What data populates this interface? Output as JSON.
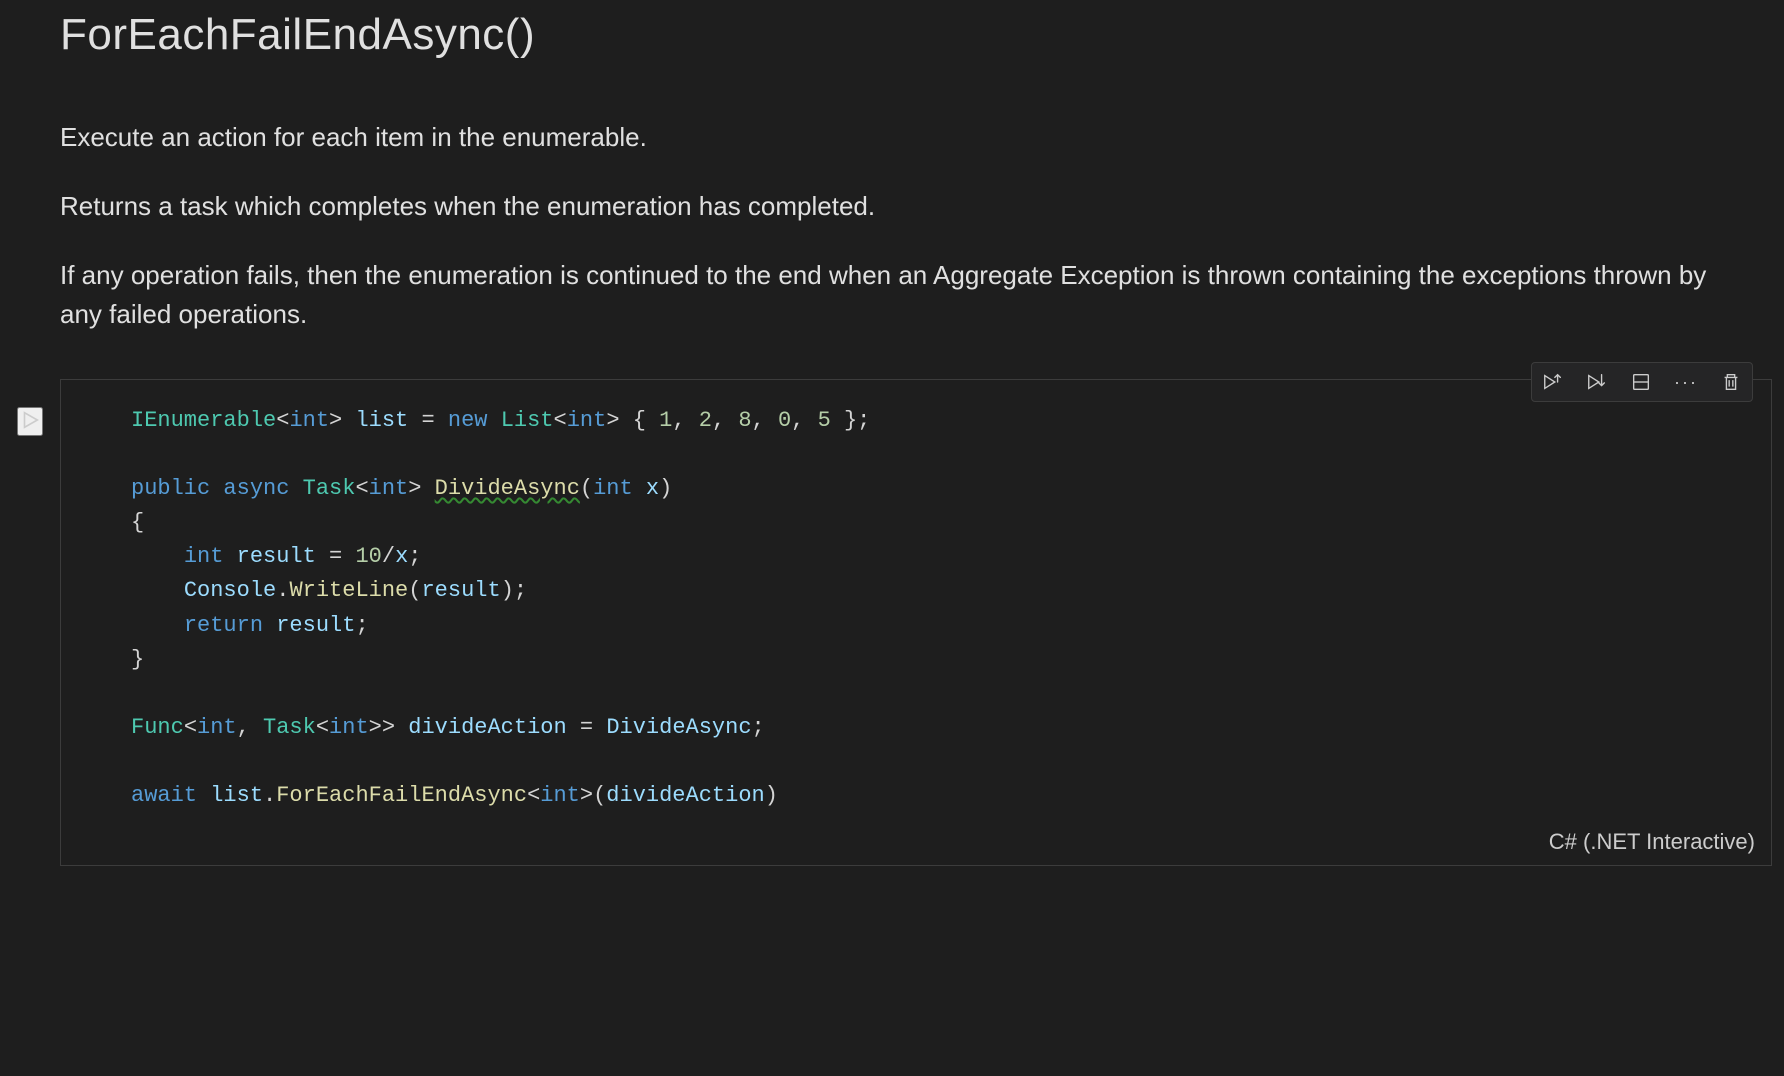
{
  "header": {
    "title": "ForEachFailEndAsync()"
  },
  "description": {
    "p1": "Execute an action for each item in the enumerable.",
    "p2": "Returns a task which completes when the enumeration has completed.",
    "p3": "If any operation fails, then the enumeration is continued to the end when an Aggregate Exception is thrown containing the exceptions thrown by any failed operations."
  },
  "cell": {
    "language_label": "C# (.NET Interactive)",
    "code": {
      "line1": {
        "kw1": "IEnumerable",
        "type1": "int",
        "var1": "list",
        "op1": "=",
        "kw2": "new",
        "type2": "List",
        "type3": "int",
        "nums": "1, 2, 8, 0, 5",
        "n1": "1",
        "n2": "2",
        "n3": "8",
        "n4": "0",
        "n5": "5"
      },
      "line2": {
        "kw1": "public",
        "kw2": "async",
        "type1": "Task",
        "type2": "int",
        "fn": "DivideAsync",
        "ptype": "int",
        "pname": "x"
      },
      "line3": {
        "type": "int",
        "var": "result",
        "op": "=",
        "expr1": "10",
        "expr2": "/",
        "expr3": "x"
      },
      "line4": {
        "cls": "Console",
        "fn": "WriteLine",
        "arg": "result"
      },
      "line5": {
        "kw": "return",
        "var": "result"
      },
      "line6": {
        "type1": "Func",
        "type2": "int",
        "type3": "Task",
        "type4": "int",
        "var": "divideAction",
        "op": "=",
        "val": "DivideAsync"
      },
      "line7": {
        "kw": "await",
        "var": "list",
        "fn": "ForEachFailEndAsync",
        "type": "int",
        "arg": "divideAction"
      }
    }
  },
  "toolbar": {
    "run_by_line": "Run by line",
    "execute_below": "Execute cells below",
    "split": "Split cell",
    "more": "More actions",
    "delete": "Delete cell"
  }
}
